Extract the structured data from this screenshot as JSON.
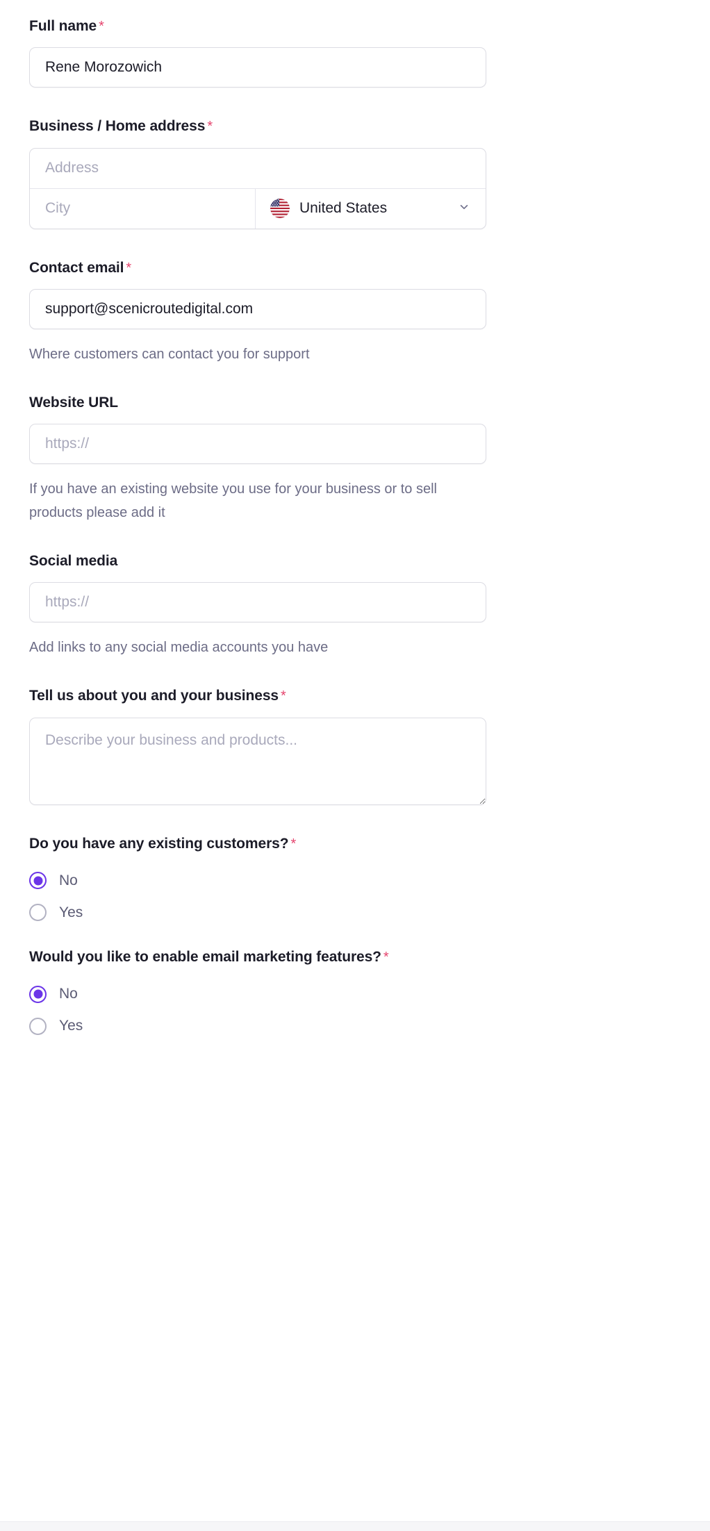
{
  "form": {
    "fields": [
      {
        "id": "full-name",
        "label": "Full name",
        "required": true,
        "value": "Rene Morozowich",
        "placeholder": ""
      },
      {
        "id": "business-home-address",
        "label": "Business / Home address",
        "required": true,
        "address_placeholder": "Address",
        "city_placeholder": "City",
        "country_value": "United States",
        "country_flag": "us-flag-icon",
        "chevron": "chevron-down-icon"
      },
      {
        "id": "contact-email",
        "label": "Contact email",
        "required": true,
        "value": "support@scenicroutedigital.com",
        "helper": "Where customers can contact you for support"
      },
      {
        "id": "website-url",
        "label": "Website URL",
        "required": false,
        "value": "",
        "placeholder": "https://",
        "helper": "If you have an existing website you use for your business or to sell products please add it"
      },
      {
        "id": "social-media",
        "label": "Social media",
        "required": false,
        "value": "",
        "placeholder": "https://",
        "helper": "Add links to any social media accounts you have"
      },
      {
        "id": "about-business",
        "label": "Tell us about you and your business",
        "required": true,
        "value": "",
        "placeholder": "Describe your business and products..."
      },
      {
        "id": "existing-customers",
        "label": "Do you have any existing customers?",
        "required": true,
        "options": [
          {
            "label": "No",
            "selected": true
          },
          {
            "label": "Yes",
            "selected": false
          }
        ]
      },
      {
        "id": "email-marketing",
        "label": "Would you like to enable email marketing features?",
        "required": true,
        "options": [
          {
            "label": "No",
            "selected": true
          },
          {
            "label": "Yes",
            "selected": false
          }
        ]
      }
    ],
    "required_marker": "*"
  },
  "colors": {
    "accent": "#6b35e8",
    "required": "#e5456e",
    "label": "#1c1c28",
    "helper": "#6c6c86",
    "placeholder": "#a9a9bb",
    "border": "#dcdce3",
    "background": "#ffffff"
  }
}
